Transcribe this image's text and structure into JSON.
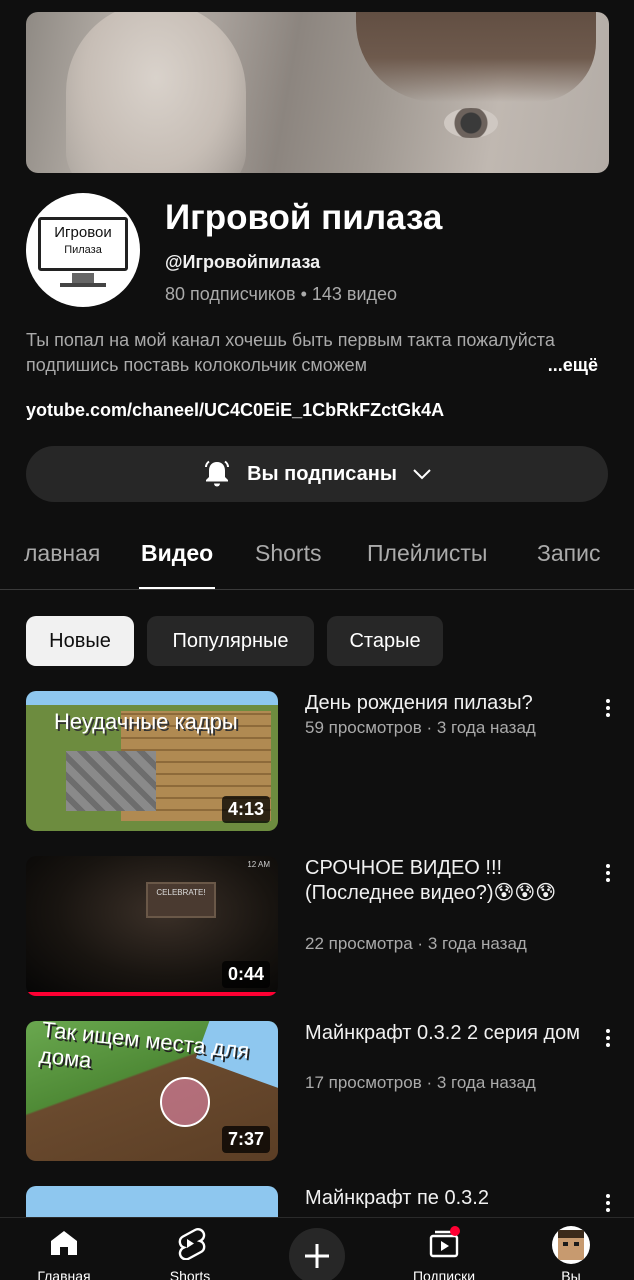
{
  "channel": {
    "name": "Игровой пилаза",
    "handle": "@Игровойпилаза",
    "stats": "80 подписчиков • 143 видео",
    "avatar_text_1": "Игровои",
    "avatar_text_2": "Пилаза",
    "description": "Ты попал на мой канал хочешь быть первым такта пожалуйста подпишись поставь колокольчик сможем",
    "more_label": "...ещё",
    "link": "yotube.com/chaneel/UC4C0EiE_1CbRkFZctGk4A"
  },
  "subscribe": {
    "label": "Вы подписаны",
    "icon": "bell-icon"
  },
  "tabs": [
    {
      "label": "лавная",
      "active": false
    },
    {
      "label": "Видео",
      "active": true
    },
    {
      "label": "Shorts",
      "active": false
    },
    {
      "label": "Плейлисты",
      "active": false
    },
    {
      "label": "Запис",
      "active": false
    }
  ],
  "filters": [
    {
      "label": "Новые",
      "selected": true
    },
    {
      "label": "Популярные",
      "selected": false
    },
    {
      "label": "Старые",
      "selected": false
    }
  ],
  "videos": [
    {
      "title": "День рождения пилазы?",
      "meta": "59 просмотров · 3 года назад",
      "duration": "4:13",
      "thumb_caption": "Неудачные кадры"
    },
    {
      "title": "СРОЧНОЕ ВИДЕО !!! (Последнее видео?)😰😰😰",
      "meta": "22 просмотра · 3 года назад",
      "duration": "0:44",
      "thumb_caption": "CELEBRATE!",
      "thumb_hud": "12 AM"
    },
    {
      "title": "Майнкрафт 0.3.2 2 серия дом",
      "meta": "17 просмотров · 3 года назад",
      "duration": "7:37",
      "thumb_caption": "Так ищем места для дома"
    },
    {
      "title": "Майнкрафт пе 0.3.2",
      "meta": "",
      "duration": ""
    }
  ],
  "nav": {
    "home": "Главная",
    "shorts": "Shorts",
    "subscriptions": "Подписки",
    "you": "Вы"
  },
  "colors": {
    "background": "#0f0f0f",
    "chip": "#272727",
    "accent_red": "#ff0033"
  }
}
